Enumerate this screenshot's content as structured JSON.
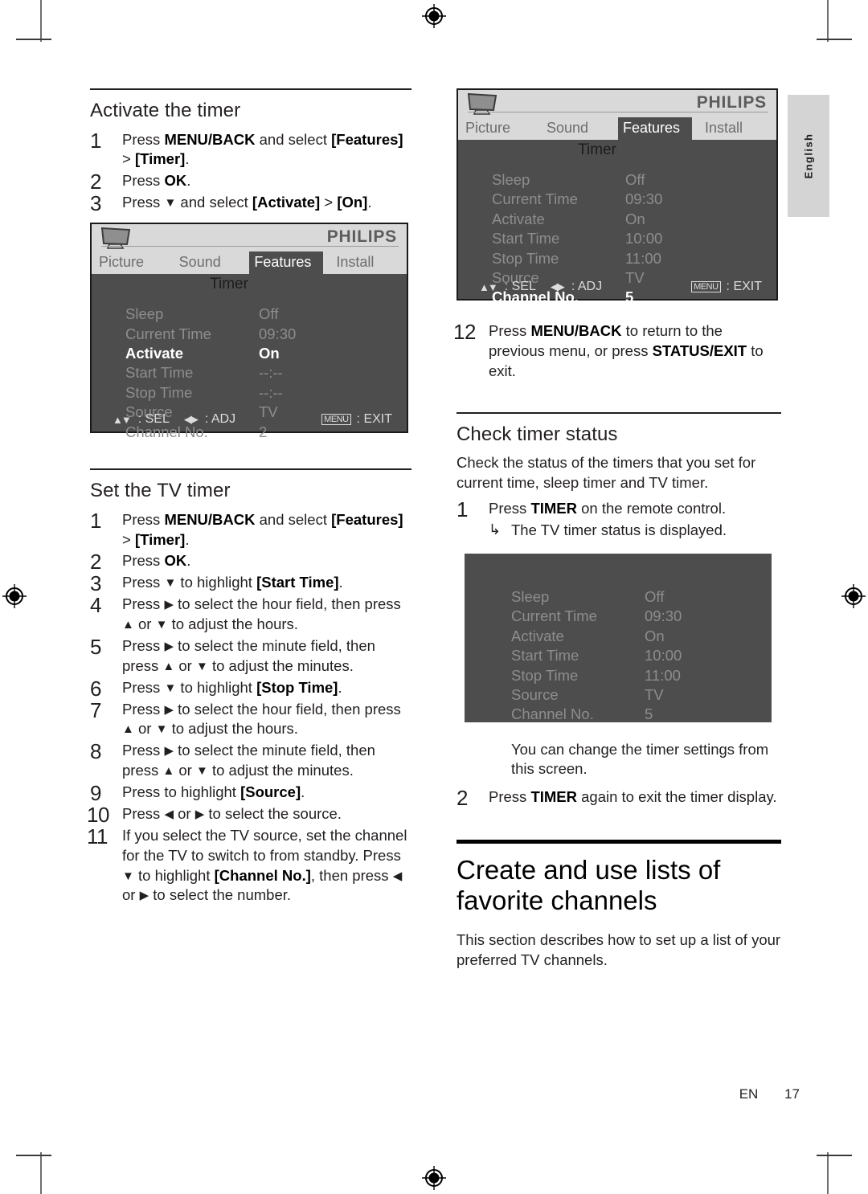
{
  "page": {
    "footer_label": "EN",
    "page_number": "17",
    "language_tab": "English"
  },
  "left_column": {
    "activate_section": {
      "title": "Activate the timer",
      "steps": [
        {
          "num": "1",
          "html": "Press <b>MENU/BACK</b> and select <b>[Features]</b> &gt; <b>[Timer]</b>."
        },
        {
          "num": "2",
          "html": "Press <b>OK</b>."
        },
        {
          "num": "3",
          "html": "Press <span class=\"arrow\">▼</span> and select <b>[Activate]</b> &gt; <b>[On]</b>."
        }
      ]
    },
    "osd_activate": {
      "brand": "PHILIPS",
      "tabs": [
        "Picture",
        "Sound",
        "Features",
        "Install"
      ],
      "active_tab": "Features",
      "subtitle": "Timer",
      "rows": [
        {
          "label": "Sleep",
          "value": "Off",
          "highlighted": false
        },
        {
          "label": "Current Time",
          "value": "09:30",
          "highlighted": false
        },
        {
          "label": "Activate",
          "value": "On",
          "highlighted": true
        },
        {
          "label": "Start Time",
          "value": "--:--",
          "highlighted": false
        },
        {
          "label": "Stop Time",
          "value": "--:--",
          "highlighted": false
        },
        {
          "label": "Source",
          "value": "TV",
          "highlighted": false
        },
        {
          "label": "Channel No.",
          "value": "2",
          "highlighted": false
        }
      ],
      "footer": {
        "sel": ": SEL",
        "adj": ": ADJ",
        "menu_key": "MENU",
        "exit": ": EXIT"
      }
    },
    "settv_section": {
      "title": "Set the TV timer",
      "steps": [
        {
          "num": "1",
          "html": "Press <b>MENU/BACK</b> and select <b>[Features]</b> &gt; <b>[Timer]</b>."
        },
        {
          "num": "2",
          "html": "Press <b>OK</b>."
        },
        {
          "num": "3",
          "html": "Press <span class=\"arrow\">▼</span> to highlight <b>[Start Time]</b>."
        },
        {
          "num": "4",
          "html": "Press <span class=\"arrow\">▶</span> to select the hour field, then press <span class=\"arrow\">▲</span> or <span class=\"arrow\">▼</span> to adjust the hours."
        },
        {
          "num": "5",
          "html": "Press <span class=\"arrow\">▶</span> to select the minute field, then press <span class=\"arrow\">▲</span> or <span class=\"arrow\">▼</span> to adjust the minutes."
        },
        {
          "num": "6",
          "html": "Press <span class=\"arrow\">▼</span> to highlight <b>[Stop Time]</b>."
        },
        {
          "num": "7",
          "html": "Press <span class=\"arrow\">▶</span> to select the hour field, then press <span class=\"arrow\">▲</span> or <span class=\"arrow\">▼</span> to adjust the hours."
        },
        {
          "num": "8",
          "html": "Press <span class=\"arrow\">▶</span> to select the minute field, then press <span class=\"arrow\">▲</span> or <span class=\"arrow\">▼</span> to adjust the minutes."
        },
        {
          "num": "9",
          "html": "Press to highlight <b>[Source]</b>."
        },
        {
          "num": "10",
          "html": "Press <span class=\"arrow\">◀</span> or <span class=\"arrow\">▶</span> to select the source."
        },
        {
          "num": "11",
          "html": "If you select the TV source, set the channel for the TV to switch to from standby. Press <span class=\"arrow\">▼</span> to highlight <b>[Channel No.]</b>, then press <span class=\"arrow\">◀</span> or <span class=\"arrow\">▶</span> to select the number."
        }
      ]
    }
  },
  "right_column": {
    "osd_settimer": {
      "brand": "PHILIPS",
      "tabs": [
        "Picture",
        "Sound",
        "Features",
        "Install"
      ],
      "active_tab": "Features",
      "subtitle": "Timer",
      "rows": [
        {
          "label": "Sleep",
          "value": "Off",
          "highlighted": false
        },
        {
          "label": "Current Time",
          "value": "09:30",
          "highlighted": false
        },
        {
          "label": "Activate",
          "value": "On",
          "highlighted": false
        },
        {
          "label": "Start Time",
          "value": "10:00",
          "highlighted": false
        },
        {
          "label": "Stop Time",
          "value": "11:00",
          "highlighted": false
        },
        {
          "label": "Source",
          "value": "TV",
          "highlighted": false
        },
        {
          "label": "Channel No.",
          "value": "5",
          "highlighted": true
        }
      ],
      "footer": {
        "sel": ": SEL",
        "adj": ": ADJ",
        "menu_key": "MENU",
        "exit": ": EXIT"
      }
    },
    "step12": {
      "num": "12",
      "html": "Press <b>MENU/BACK</b> to return to the previous menu, or press <b>STATUS/EXIT</b> to exit."
    },
    "check_section": {
      "title": "Check timer status",
      "intro": "Check the status of the timers that you set for current time, sleep timer and TV timer.",
      "step1": {
        "num": "1",
        "html": "Press <b>TIMER</b> on the remote control."
      },
      "step1_note": "The TV timer status is displayed.",
      "osd_status": {
        "rows": [
          {
            "label": "Sleep",
            "value": "Off"
          },
          {
            "label": "Current Time",
            "value": "09:30"
          },
          {
            "label": "Activate",
            "value": "On"
          },
          {
            "label": "Start Time",
            "value": "10:00"
          },
          {
            "label": "Stop Time",
            "value": "11:00"
          },
          {
            "label": "Source",
            "value": "TV"
          },
          {
            "label": "Channel No.",
            "value": "5"
          }
        ]
      },
      "after_note": "You can change the timer settings from this screen.",
      "step2": {
        "num": "2",
        "html": "Press <b>TIMER</b> again to exit the timer display."
      }
    },
    "favorites_section": {
      "title": "Create and use lists of favorite channels",
      "body": "This section describes how to set up a list of your preferred TV channels."
    }
  }
}
